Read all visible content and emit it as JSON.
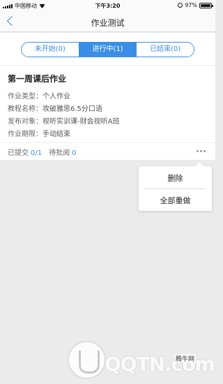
{
  "status_bar": {
    "carrier": "中国移动",
    "time": "下午3:20",
    "battery": "97%",
    "battery_level": 0.97
  },
  "nav": {
    "title": "作业测试"
  },
  "tabs": [
    {
      "label": "未开始(0)",
      "active": false
    },
    {
      "label": "进行中(1)",
      "active": true
    },
    {
      "label": "已结束(0)",
      "active": false
    }
  ],
  "card": {
    "title": "第一周课后作业",
    "type_label": "作业类型：",
    "type_value": "个人作业",
    "course_label": "教程名称：",
    "course_value": "攻破雅思6.5分口语",
    "target_label": "发布对象：",
    "target_value": "视听实训课-财会视听A班",
    "deadline_label": "作业期限：",
    "deadline_value": "手动结束",
    "submitted_label": "已提交",
    "submitted_value": "0/1",
    "pending_label": "待批阅",
    "pending_value": "0"
  },
  "popup": {
    "delete_label": "删除",
    "redo_label": "全部重做"
  },
  "watermark": {
    "text": "QQTN.com",
    "site": "腾牛网"
  },
  "colors": {
    "accent": "#3a8ee6",
    "background": "#ebebeb"
  }
}
